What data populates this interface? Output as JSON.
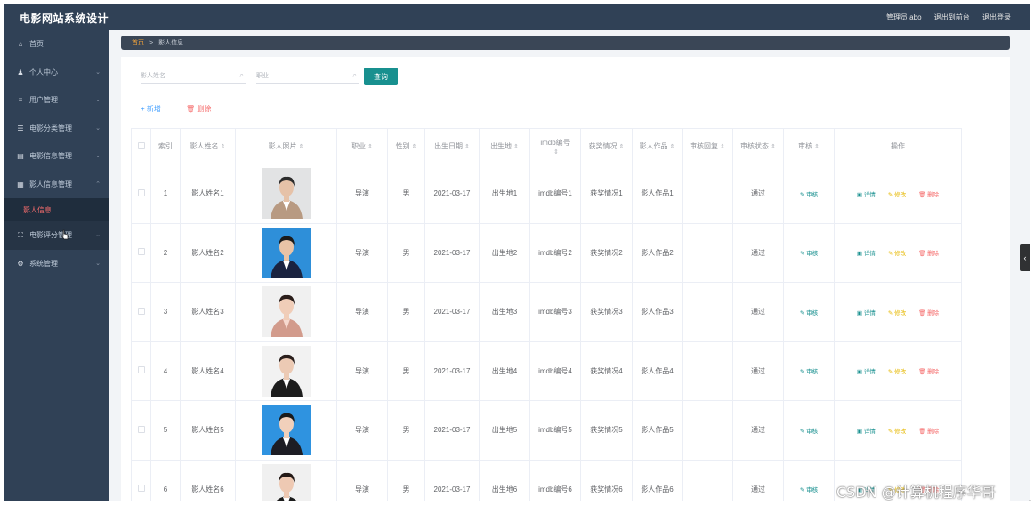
{
  "header": {
    "app_title": "电影网站系统设计",
    "admin_label": "管理员 abo",
    "frontend_link": "退出到前台",
    "logout_link": "退出登录"
  },
  "sidebar": {
    "items": [
      {
        "label": "首页",
        "icon": "home-icon"
      },
      {
        "label": "个人中心",
        "icon": "user-icon"
      },
      {
        "label": "用户管理",
        "icon": "list-icon"
      },
      {
        "label": "电影分类管理",
        "icon": "sliders-icon"
      },
      {
        "label": "电影信息管理",
        "icon": "film-icon"
      },
      {
        "label": "影人信息管理",
        "icon": "card-icon"
      },
      {
        "label": "影人信息",
        "icon": ""
      },
      {
        "label": "电影评分管理",
        "icon": "frame-icon"
      },
      {
        "label": "系统管理",
        "icon": "gear-icon"
      }
    ]
  },
  "breadcrumb": {
    "home": "首页",
    "separator": ">",
    "current": "影人信息"
  },
  "search": {
    "name_placeholder": "影人姓名",
    "job_placeholder": "职业",
    "query_label": "查询"
  },
  "actions": {
    "add_label": "+ 新增",
    "delete_label": "删除"
  },
  "table": {
    "columns": [
      "索引",
      "影人姓名",
      "影人照片",
      "职业",
      "性别",
      "出生日期",
      "出生地",
      "imdb编号",
      "获奖情况",
      "影人作品",
      "审核回复",
      "审核状态",
      "审核",
      "操作"
    ],
    "rows": [
      {
        "index": "1",
        "name": "影人姓名1",
        "job": "导演",
        "gender": "男",
        "birth": "2021-03-17",
        "place": "出生地1",
        "imdb": "imdb编号1",
        "award": "获奖情况1",
        "works": "影人作品1",
        "reply": "",
        "status": "通过"
      },
      {
        "index": "2",
        "name": "影人姓名2",
        "job": "导演",
        "gender": "男",
        "birth": "2021-03-17",
        "place": "出生地2",
        "imdb": "imdb编号2",
        "award": "获奖情况2",
        "works": "影人作品2",
        "reply": "",
        "status": "通过"
      },
      {
        "index": "3",
        "name": "影人姓名3",
        "job": "导演",
        "gender": "男",
        "birth": "2021-03-17",
        "place": "出生地3",
        "imdb": "imdb编号3",
        "award": "获奖情况3",
        "works": "影人作品3",
        "reply": "",
        "status": "通过"
      },
      {
        "index": "4",
        "name": "影人姓名4",
        "job": "导演",
        "gender": "男",
        "birth": "2021-03-17",
        "place": "出生地4",
        "imdb": "imdb编号4",
        "award": "获奖情况4",
        "works": "影人作品4",
        "reply": "",
        "status": "通过"
      },
      {
        "index": "5",
        "name": "影人姓名5",
        "job": "导演",
        "gender": "男",
        "birth": "2021-03-17",
        "place": "出生地5",
        "imdb": "imdb编号5",
        "award": "获奖情况5",
        "works": "影人作品5",
        "reply": "",
        "status": "通过"
      },
      {
        "index": "6",
        "name": "影人姓名6",
        "job": "导演",
        "gender": "男",
        "birth": "2021-03-17",
        "place": "出生地6",
        "imdb": "imdb编号6",
        "award": "获奖情况6",
        "works": "影人作品6",
        "reply": "",
        "status": "通过"
      }
    ],
    "review_label": "审核",
    "op_detail": "详情",
    "op_edit": "修改",
    "op_delete": "删除"
  },
  "watermark": "CSDN @计算机程序华哥",
  "colors": {
    "sidebar_bg": "#304156",
    "accent_teal": "#18908f",
    "link_blue": "#409eff",
    "danger_red": "#f56c6c",
    "edit_yellow": "#e6b800"
  }
}
